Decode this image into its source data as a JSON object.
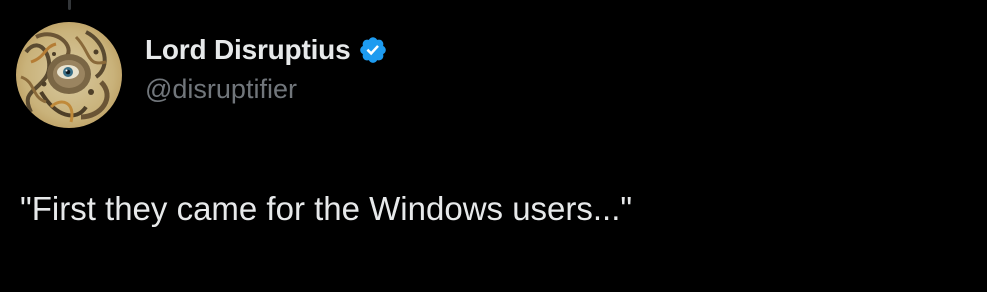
{
  "author": {
    "display_name": "Lord Disruptius",
    "handle": "@disruptifier",
    "verified": true,
    "verified_icon": "verified-badge-icon",
    "avatar_icon": "avatar-image"
  },
  "tweet": {
    "text": "\"First they came for the Windows users...\""
  },
  "colors": {
    "background": "#000000",
    "primary_text": "#e7e9ea",
    "secondary_text": "#71767b",
    "verified_blue": "#1d9bf0"
  }
}
